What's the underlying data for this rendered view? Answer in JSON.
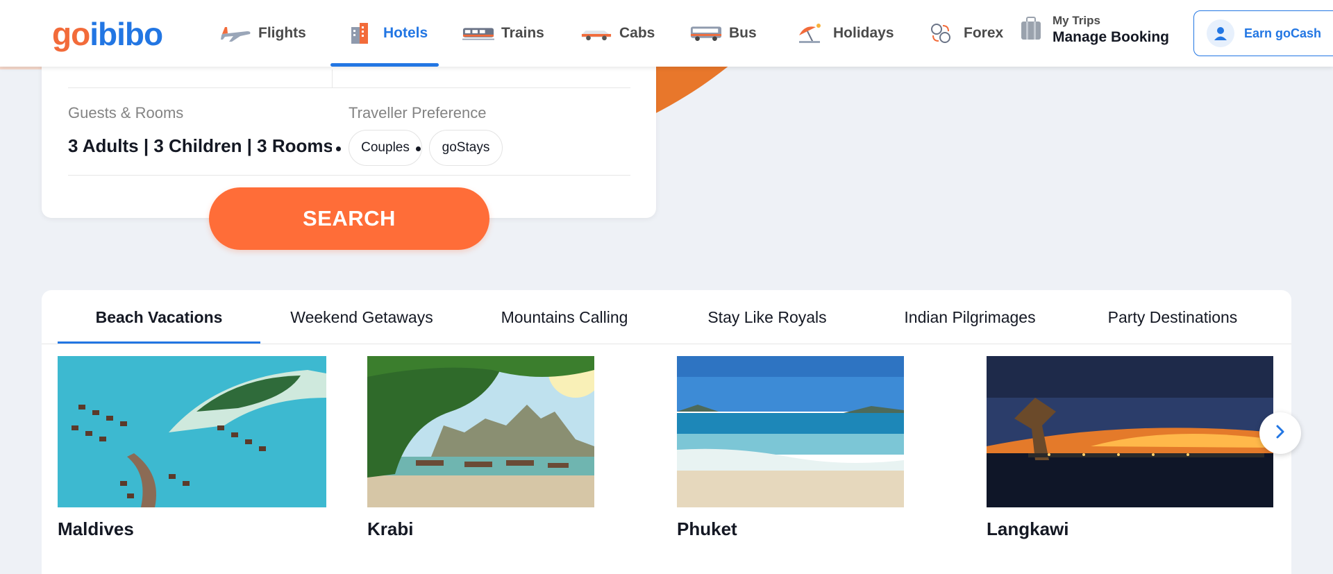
{
  "brand": {
    "logo_part1": "go",
    "logo_part2": "ibibo"
  },
  "nav": {
    "items": [
      {
        "label": "Flights",
        "icon": "airplane-icon"
      },
      {
        "label": "Hotels",
        "icon": "hotel-building-icon",
        "active": true
      },
      {
        "label": "Trains",
        "icon": "train-icon"
      },
      {
        "label": "Cabs",
        "icon": "cab-icon"
      },
      {
        "label": "Bus",
        "icon": "bus-icon"
      },
      {
        "label": "Holidays",
        "icon": "beach-umbrella-icon"
      },
      {
        "label": "Forex",
        "icon": "currency-exchange-icon"
      }
    ],
    "my_trips_small": "My Trips",
    "my_trips_big": "Manage Booking",
    "earn_label": "Earn goCash"
  },
  "search": {
    "guests_label": "Guests & Rooms",
    "guests_value": "3 Adults  | 3 Children | 3 Rooms",
    "pref_label": "Traveller Preference",
    "chips": [
      "Couples",
      "goStays"
    ],
    "button_label": "SEARCH"
  },
  "collections": {
    "tabs": [
      "Beach Vacations",
      "Weekend Getaways",
      "Mountains Calling",
      "Stay Like Royals",
      "Indian Pilgrimages",
      "Party Destinations"
    ],
    "active_tab": "Beach Vacations",
    "destinations": [
      "Maldives",
      "Krabi",
      "Phuket",
      "Langkawi"
    ]
  },
  "colors": {
    "accent_blue": "#2276e3",
    "accent_orange": "#ff6d38",
    "logo_orange": "#f26b3a"
  }
}
